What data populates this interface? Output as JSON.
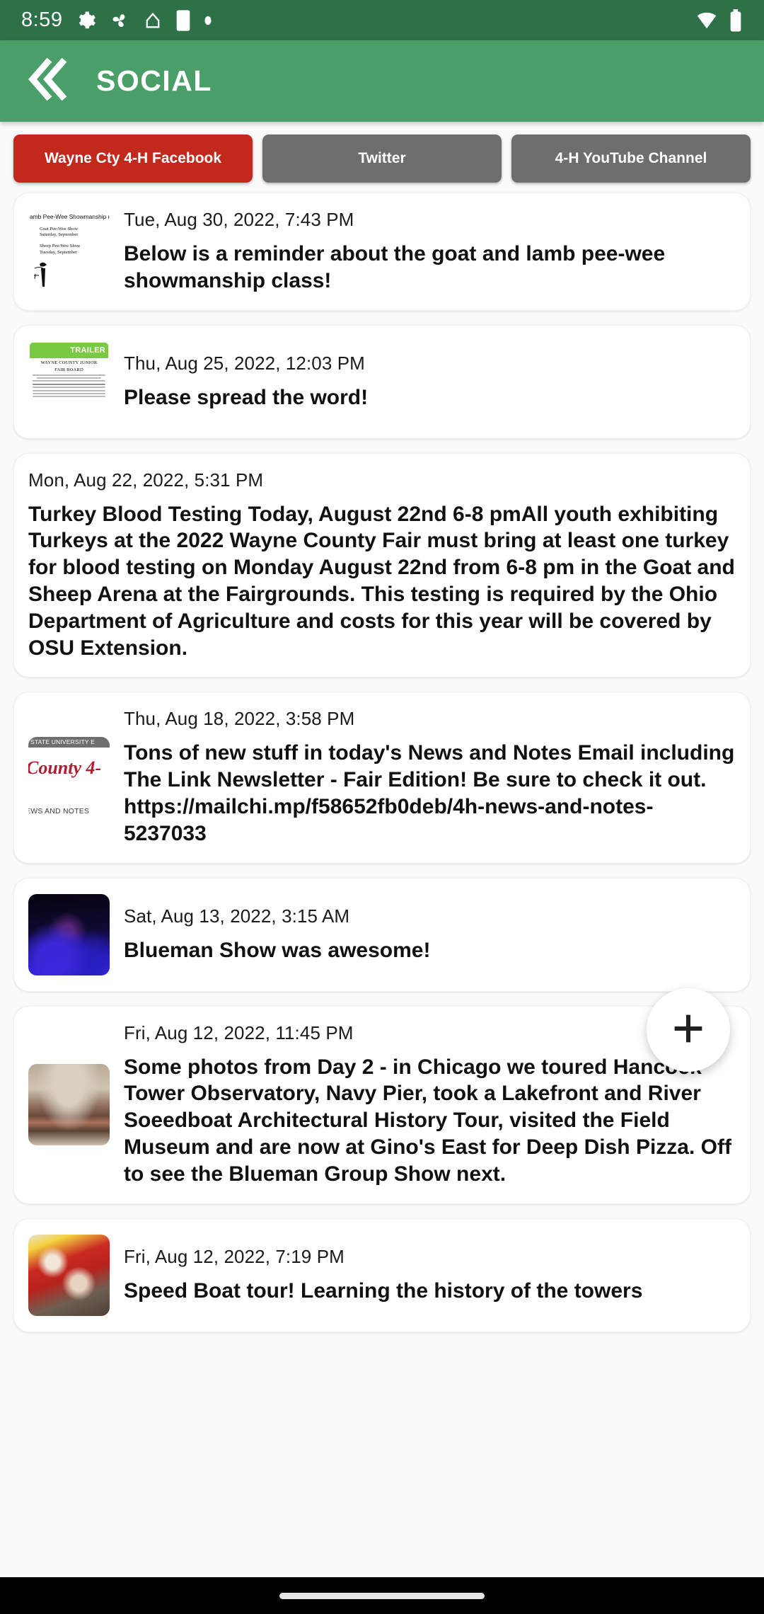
{
  "status_bar": {
    "time": "8:59",
    "icons": [
      "gear-icon",
      "pinwheel-icon",
      "home-outline-icon",
      "battery-saver-icon",
      "dot-icon"
    ],
    "right_icons": [
      "wifi-icon",
      "battery-icon"
    ],
    "background_color": "#2e7048"
  },
  "app_bar": {
    "title": "SOCIAL",
    "back_icon": "double-chevron-left-icon",
    "background_color": "#4a9e68"
  },
  "tabs": [
    {
      "label": "Wayne Cty 4-H Facebook",
      "active": true,
      "color": "#c2291c"
    },
    {
      "label": "Twitter",
      "active": false,
      "color": "#6e6e6e"
    },
    {
      "label": "4-H YouTube Channel",
      "active": false,
      "color": "#6e6e6e"
    }
  ],
  "posts": [
    {
      "date": "Tue, Aug 30, 2022, 7:43 PM",
      "text": "Below is a reminder about the goat and lamb pee-wee showmanship class!",
      "thumbnail": "goat-lamb-showmanship-flyer",
      "thumb_text": {
        "heading": "amb Pee-Wee Showmanship R",
        "line1": "Goat Pee-Wee Show",
        "line2": "Saturday, September",
        "line3": "Sheep Pee-Wee Show",
        "line4": "Tuesday, September"
      }
    },
    {
      "date": "Thu, Aug 25, 2022, 12:03 PM",
      "text": "Please spread the word!",
      "thumbnail": "stock-the-trailer-flyer",
      "thumb_text": {
        "banner": "TRAILER",
        "line1": "WAYNE COUNTY JUNIOR",
        "line2": "FAIR BOARD"
      }
    },
    {
      "date": "Mon, Aug 22, 2022, 5:31 PM",
      "text": "Turkey Blood Testing Today, August 22nd 6-8 pmAll youth exhibiting Turkeys at the 2022 Wayne County Fair must bring at least one turkey for blood testing on Monday August 22nd from 6-8 pm in the Goat and Sheep Arena at the Fairgrounds.  This testing is required by the Ohio Department of Agriculture and costs for this year will be covered by OSU Extension.",
      "thumbnail": null
    },
    {
      "date": "Thu, Aug 18, 2022, 3:58 PM",
      "text": "Tons of new stuff in today's News and Notes Email including The Link Newsletter - Fair Edition!  Be sure to check it out. https://mailchi.mp/f58652fb0deb/4h-news-and-notes-5237033",
      "thumbnail": "county-4h-news-and-notes-logo",
      "thumb_text": {
        "topbar": "STATE UNIVERSITY E",
        "script": "County 4-",
        "bottom": "EWS AND NOTES"
      }
    },
    {
      "date": "Sat, Aug 13, 2022, 3:15 AM",
      "text": "Blueman Show was awesome!",
      "thumbnail": "blueman-show-photo"
    },
    {
      "date": "Fri, Aug 12, 2022, 11:45 PM",
      "text": "Some photos from Day 2 - in Chicago we toured Hancock Tower Observatory, Navy Pier, took a Lakefront and River Soeedboat Architectural History Tour, visited the Field Museum and are now at Gino's East for Deep Dish Pizza.  Off to see the Blueman Group Show next.",
      "thumbnail": "chicago-group-photo"
    },
    {
      "date": "Fri, Aug 12, 2022, 7:19 PM",
      "text": "Speed Boat tour! Learning the history of the towers",
      "thumbnail": "speed-boat-group-photo"
    }
  ],
  "fab": {
    "icon": "plus-icon",
    "label": "add"
  },
  "nav_bar": {
    "gesture_pill": "home-indicator"
  }
}
